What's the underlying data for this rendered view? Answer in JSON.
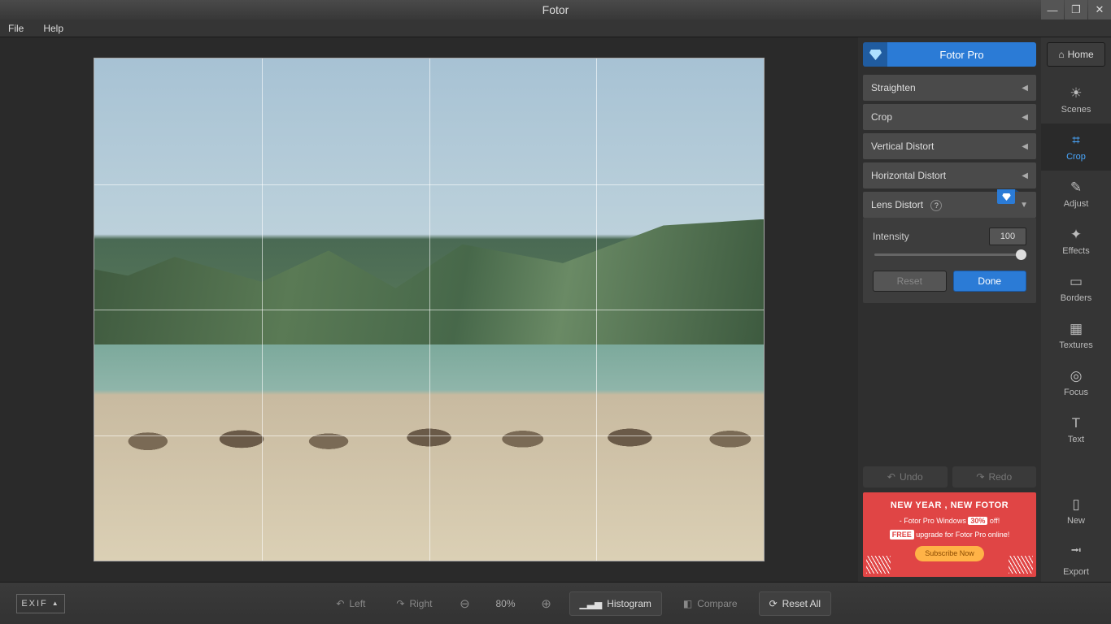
{
  "app_title": "Fotor",
  "menu": {
    "file": "File",
    "help": "Help"
  },
  "header": {
    "pro": "Fotor Pro",
    "home": "Home"
  },
  "tools": {
    "scenes": "Scenes",
    "crop": "Crop",
    "adjust": "Adjust",
    "effects": "Effects",
    "borders": "Borders",
    "textures": "Textures",
    "focus": "Focus",
    "text": "Text",
    "new": "New",
    "export": "Export"
  },
  "panels": {
    "straighten": "Straighten",
    "crop": "Crop",
    "vdistort": "Vertical Distort",
    "hdistort": "Horizontal Distort",
    "lens": "Lens Distort"
  },
  "lens": {
    "intensity_label": "Intensity",
    "intensity_value": "100",
    "reset": "Reset",
    "done": "Done"
  },
  "history": {
    "undo": "Undo",
    "redo": "Redo"
  },
  "promo": {
    "line1": "NEW YEAR , NEW FOTOR",
    "prefix": "- Fotor Pro Windows ",
    "pct": "30%",
    "suffix": " off!",
    "free": "FREE",
    "upgrade": " upgrade for Fotor Pro online!",
    "cta": "Subscribe Now"
  },
  "bottom": {
    "exif": "EXIF",
    "left": "Left",
    "right": "Right",
    "zoom": "80%",
    "histogram": "Histogram",
    "compare": "Compare",
    "reset_all": "Reset  All"
  }
}
